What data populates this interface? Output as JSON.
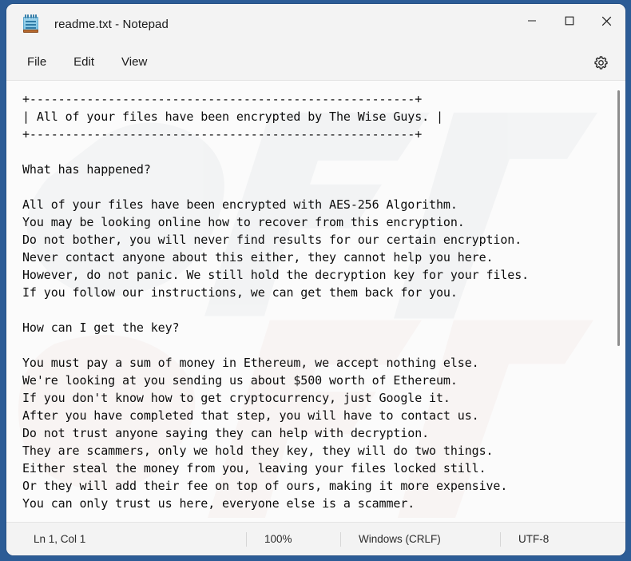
{
  "window": {
    "title": "readme.txt - Notepad",
    "app_icon": "notepad-icon",
    "controls": {
      "minimize": "minimize-icon",
      "maximize": "maximize-icon",
      "close": "close-icon"
    }
  },
  "menubar": {
    "items": [
      {
        "label": "File"
      },
      {
        "label": "Edit"
      },
      {
        "label": "View"
      }
    ],
    "settings_icon": "gear-icon"
  },
  "editor": {
    "content": "+------------------------------------------------------+\n| All of your files have been encrypted by The Wise Guys. |\n+------------------------------------------------------+\n\nWhat has happened?\n\nAll of your files have been encrypted with AES-256 Algorithm.\nYou may be looking online how to recover from this encryption.\nDo not bother, you will never find results for our certain encryption.\nNever contact anyone about this either, they cannot help you here.\nHowever, do not panic. We still hold the decryption key for your files.\nIf you follow our instructions, we can get them back for you.\n\nHow can I get the key?\n\nYou must pay a sum of money in Ethereum, we accept nothing else.\nWe're looking at you sending us about $500 worth of Ethereum.\nIf you don't know how to get cryptocurrency, just Google it.\nAfter you have completed that step, you will have to contact us.\nDo not trust anyone saying they can help with decryption.\nThey are scammers, only we hold they key, they will do two things.\nEither steal the money from you, leaving your files locked still.\nOr they will add their fee on top of ours, making it more expensive.\nYou can only trust us here, everyone else is a scammer."
  },
  "statusbar": {
    "position": "Ln 1, Col 1",
    "zoom": "100%",
    "line_ending": "Windows (CRLF)",
    "encoding": "UTF-8"
  },
  "colors": {
    "desktop": "#2c5c96",
    "window_chrome": "#f3f3f3",
    "editor_background": "#fbfbfb",
    "text": "#0d0d0d",
    "scrollbar_thumb": "#8d8d8d"
  }
}
